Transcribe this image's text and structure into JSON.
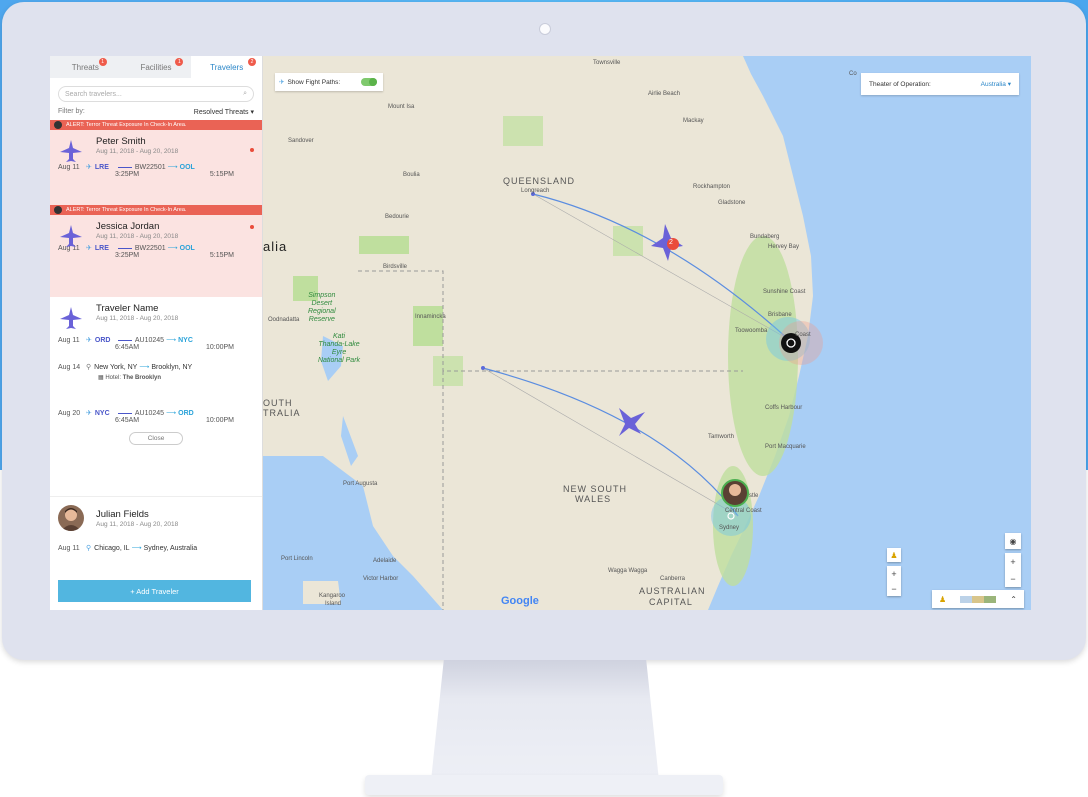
{
  "tabs": [
    {
      "label": "Threats",
      "badge": "1"
    },
    {
      "label": "Facilities",
      "badge": "1"
    },
    {
      "label": "Travelers",
      "badge": "2"
    }
  ],
  "search": {
    "placeholder": "Search travelers..."
  },
  "filter": {
    "label": "Filter by:",
    "value": "Resolved Threats"
  },
  "alert_text": "ALERT: Terror Threat Exposure In Check-In Area.",
  "travelers": [
    {
      "name": "Peter Smith",
      "dates": "Aug 11, 2018 - Aug 20, 2018",
      "leg": {
        "date": "Aug 11",
        "from": "LRE",
        "flight": "BW22501",
        "to": "OOL",
        "dep": "3:25PM",
        "arr": "5:15PM"
      }
    },
    {
      "name": "Jessica Jordan",
      "dates": "Aug 11, 2018 - Aug 20, 2018",
      "leg": {
        "date": "Aug 11",
        "from": "LRE",
        "flight": "BW22501",
        "to": "OOL",
        "dep": "3:25PM",
        "arr": "5:15PM"
      }
    },
    {
      "name": "Traveler Name",
      "dates": "Aug 11, 2018 - Aug 20, 2018",
      "leg1": {
        "date": "Aug 11",
        "from": "ORD",
        "flight": "AU10245",
        "to": "NYC",
        "dep": "6:45AM",
        "arr": "10:00PM"
      },
      "stay": {
        "date": "Aug 14",
        "from": "New York, NY",
        "to": "Brooklyn, NY",
        "hotel_label": "Hotel:",
        "hotel": "The Brooklyn"
      },
      "leg2": {
        "date": "Aug 20",
        "from": "NYC",
        "flight": "AU10245",
        "to": "ORD",
        "dep": "6:45AM",
        "arr": "10:00PM"
      },
      "close_label": "Close"
    },
    {
      "name": "Julian Fields",
      "dates": "Aug 11, 2018 - Aug 20, 2018",
      "leg": {
        "date": "Aug 11",
        "from": "Chicago, IL",
        "to": "Sydney, Australia"
      }
    }
  ],
  "add_button": "+ Add Traveler",
  "map": {
    "toggle_label": "Show Fight Paths:",
    "theater_label": "Theater of Operation:",
    "theater_value": "Australia",
    "labels": {
      "queensland": "QUEENSLAND",
      "nsw1": "NEW SOUTH",
      "nsw2": "WALES",
      "act1": "AUSTRALIAN",
      "act2": "CAPITAL",
      "alia": "alia",
      "south1": "OUTH",
      "south2": "TRALIA",
      "park1": "Simpson",
      "park2": "Desert",
      "park3": "Regional",
      "park4": "Reserve",
      "park5": "Kati",
      "park6": "Thanda-Lake",
      "park7": "Eyre",
      "park8": "National Park",
      "townsville": "Townsville",
      "airlie": "Airlie Beach",
      "mackay": "Mackay",
      "rockhampton": "Rockhampton",
      "gladstone": "Gladstone",
      "bundaberg": "Bundaberg",
      "herveybay": "Hervey Bay",
      "sunshine": "Sunshine Coast",
      "brisbane": "Brisbane",
      "toowoomba": "Toowoomba",
      "goldcoast": "Coast",
      "coffs": "Coffs Harbour",
      "tamworth": "Tamworth",
      "portmac": "Port Macquarie",
      "newcastle": "stle",
      "cencoast": "Central Coast",
      "sydney": "Sydney",
      "canberra": "Canberra",
      "wagga": "Wagga Wagga",
      "adelaide": "Adelaide",
      "portaugusta": "Port Augusta",
      "portlincoln": "Port Lincoln",
      "victorharbor": "Victor Harbor",
      "kangaroo1": "Kangaroo",
      "kangaroo2": "Island",
      "mountisa": "Mount Isa",
      "sandover": "Sandover",
      "boulia": "Boulia",
      "bedourie": "Bedourie",
      "birdsville": "Birdsville",
      "longreach": "Longreach",
      "goodnadata": "Oodnadatta",
      "innamincka": "Innamincka",
      "cairns": "Co"
    },
    "marker_badge": "2",
    "google": "Google"
  }
}
